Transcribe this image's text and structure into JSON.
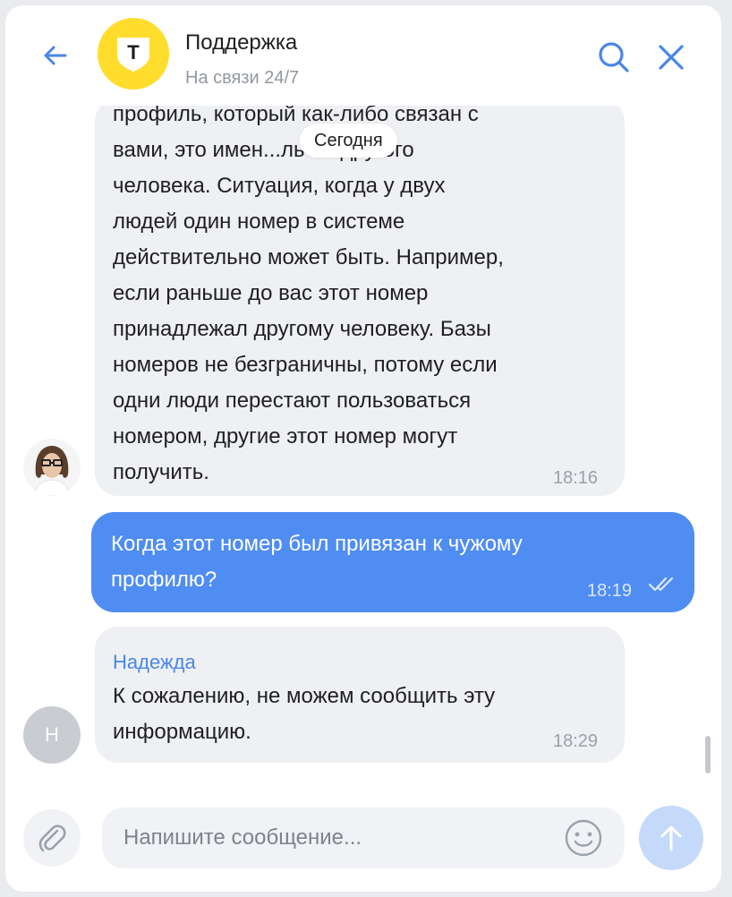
{
  "header": {
    "title": "Поддержка",
    "status": "На связи 24/7",
    "logo_letter": "Т",
    "icons": {
      "back": "back-arrow-icon",
      "search": "search-icon",
      "close": "close-icon"
    },
    "accent_color": "#4a86e8",
    "logo_color": "#ffdd2d"
  },
  "date_divider": "Сегодня",
  "messages": [
    {
      "direction": "incoming",
      "text": "профиль, который как-либо связан с\nвами, это имен...ль на другого\nчеловека. Ситуация, когда у двух\nлюдей один номер в системе\nдействительно может быть. Например,\nесли раньше до вас этот номер\nпринадлежал другому человеку. Базы\nномеров не безграничны, потому если\nодни люди перестают пользоваться\nномером, другие этот номер могут\nполучить.",
      "time": "18:16"
    },
    {
      "direction": "outgoing",
      "text": "Когда этот номер был привязан к чужому\nпрофилю?",
      "time": "18:19",
      "status_icon": "double-check-icon"
    },
    {
      "direction": "incoming",
      "sender": "Надежда",
      "avatar_initial": "Н",
      "text": "К сожалению, не можем сообщить эту\nинформацию.",
      "time": "18:29"
    }
  ],
  "composer": {
    "placeholder": "Напишите сообщение...",
    "value": "",
    "icons": {
      "attach": "paperclip-icon",
      "emoji": "smile-icon",
      "send": "send-arrow-icon"
    }
  }
}
